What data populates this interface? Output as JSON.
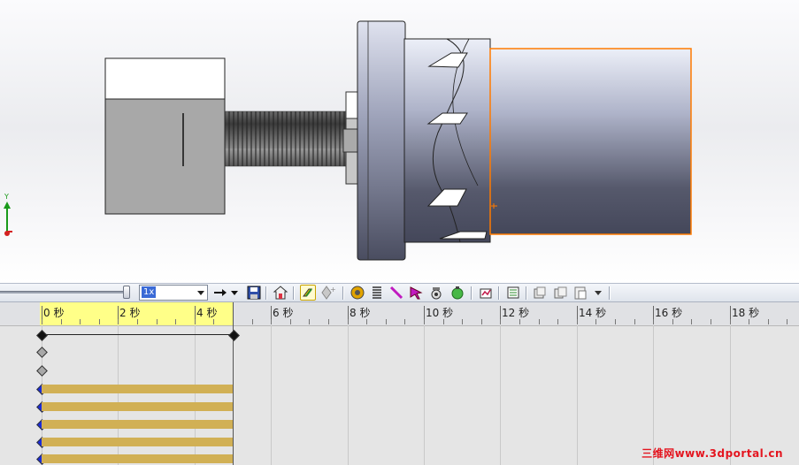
{
  "toolbar": {
    "speed_value": "1x",
    "icons": [
      "forward-arrow-icon",
      "dropdown-arrow-icon",
      "save-icon",
      "house-icon",
      "key-icon",
      "add-key-icon",
      "motor-icon",
      "spring-icon",
      "pencil-icon",
      "cursor-icon",
      "camera-icon",
      "globe-icon",
      "chart-icon",
      "list-icon",
      "collapse-icon",
      "copy-icon",
      "paste-icon",
      "more-icon"
    ]
  },
  "timeline": {
    "ticks": [
      "0 秒",
      "2 秒",
      "4 秒",
      "6 秒",
      "8 秒",
      "10 秒",
      "12 秒",
      "14 秒",
      "16 秒",
      "18 秒"
    ],
    "current_time_seconds": 5,
    "colors": {
      "highlight": "#ffff88",
      "key_bar": "#d1b055",
      "key_diamond": "#1a2bdc"
    }
  },
  "viewport": {
    "triad_label": "Y",
    "colors": {
      "selection_edge": "#ff7a00"
    }
  },
  "watermark": "三维网www.3dportal.cn"
}
